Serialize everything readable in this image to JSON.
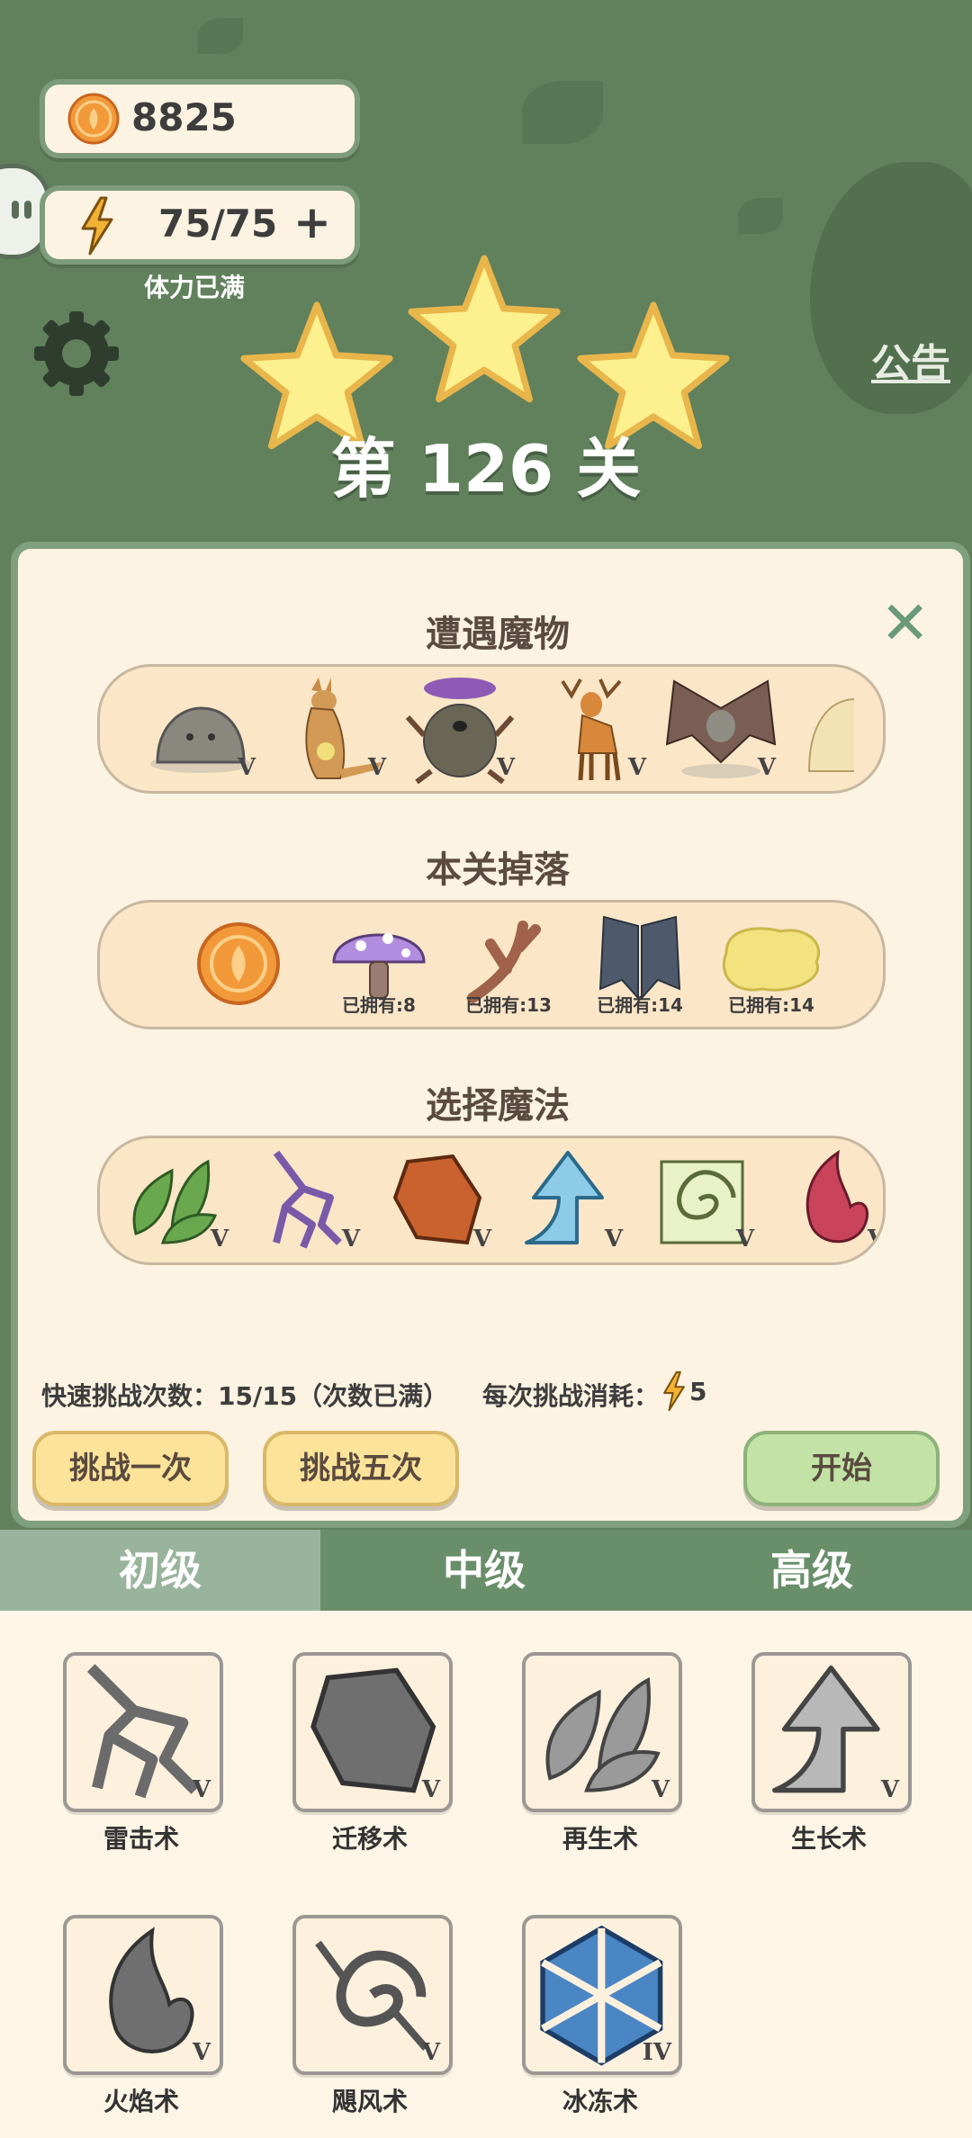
{
  "currency": {
    "coins": "8825",
    "energy": "75/75",
    "energy_status": "体力已满",
    "plus": "+"
  },
  "header": {
    "level_title": "第 126 关",
    "notice": "公告",
    "stars": 3
  },
  "panel": {
    "close": "✕",
    "monsters_title": "遭遇魔物",
    "monster_marks": [
      "V",
      "V",
      "V",
      "V",
      "V"
    ],
    "drops_title": "本关掉落",
    "drops": [
      {
        "name": "coin",
        "owned": ""
      },
      {
        "name": "mushroom",
        "owned": "已拥有:8"
      },
      {
        "name": "antler",
        "owned": "已拥有:13"
      },
      {
        "name": "bat-wings",
        "owned": "已拥有:14"
      },
      {
        "name": "slime",
        "owned": "已拥有:14"
      }
    ],
    "magic_title": "选择魔法",
    "magic_marks": [
      "V",
      "V",
      "V",
      "V",
      "V",
      "V"
    ],
    "quick_info": "快速挑战次数：15/15（次数已满）",
    "cost_label": "每次挑战消耗：",
    "cost_value": "5",
    "btn_once": "挑战一次",
    "btn_five": "挑战五次",
    "btn_start": "开始"
  },
  "tabs": [
    "初级",
    "中级",
    "高级"
  ],
  "spells": [
    {
      "label": "雷击术",
      "mark": "V"
    },
    {
      "label": "迁移术",
      "mark": "V"
    },
    {
      "label": "再生术",
      "mark": "V"
    },
    {
      "label": "生长术",
      "mark": "V"
    },
    {
      "label": "火焰术",
      "mark": "V"
    },
    {
      "label": "飓风术",
      "mark": "V"
    },
    {
      "label": "冰冻术",
      "mark": "IV"
    }
  ],
  "colors": {
    "accent_green": "#698f6a",
    "panel_bg": "#fdf3e2",
    "button_yellow": "#fce39a",
    "button_green": "#c2e3a5"
  }
}
